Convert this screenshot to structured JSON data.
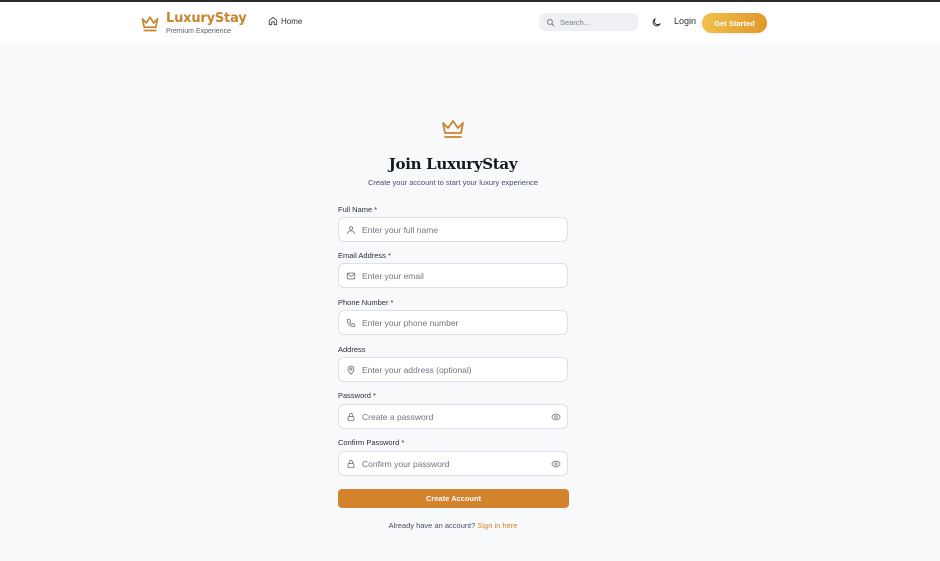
{
  "nav": {
    "brand_name": "LuxuryStay",
    "brand_tagline": "Premium Experience",
    "home_label": "Home",
    "search_placeholder": "Search...",
    "login_label": "Login",
    "get_started_label": "Get Started"
  },
  "form": {
    "title": "Join LuxuryStay",
    "subtitle": "Create your account to start your luxury experience",
    "fields": [
      {
        "label": "Full Name *",
        "placeholder": "Enter your full name",
        "icon": "user-icon"
      },
      {
        "label": "Email Address *",
        "placeholder": "Enter your email",
        "icon": "mail-icon"
      },
      {
        "label": "Phone Number *",
        "placeholder": "Enter your phone number",
        "icon": "phone-icon"
      },
      {
        "label": "Address",
        "placeholder": "Enter your address (optional)",
        "icon": "map-pin-icon"
      },
      {
        "label": "Password *",
        "placeholder": "Create a password",
        "icon": "lock-icon"
      },
      {
        "label": "Confirm Password *",
        "placeholder": "Confirm your password",
        "icon": "lock-icon"
      }
    ],
    "submit_label": "Create Account",
    "signin_prompt": "Already have an account?",
    "signin_link": "Sign in here"
  },
  "colors": {
    "accent": "#d3832c",
    "brand": "#c9842b",
    "gradient_start": "#f2c04a",
    "gradient_end": "#e0982c"
  }
}
